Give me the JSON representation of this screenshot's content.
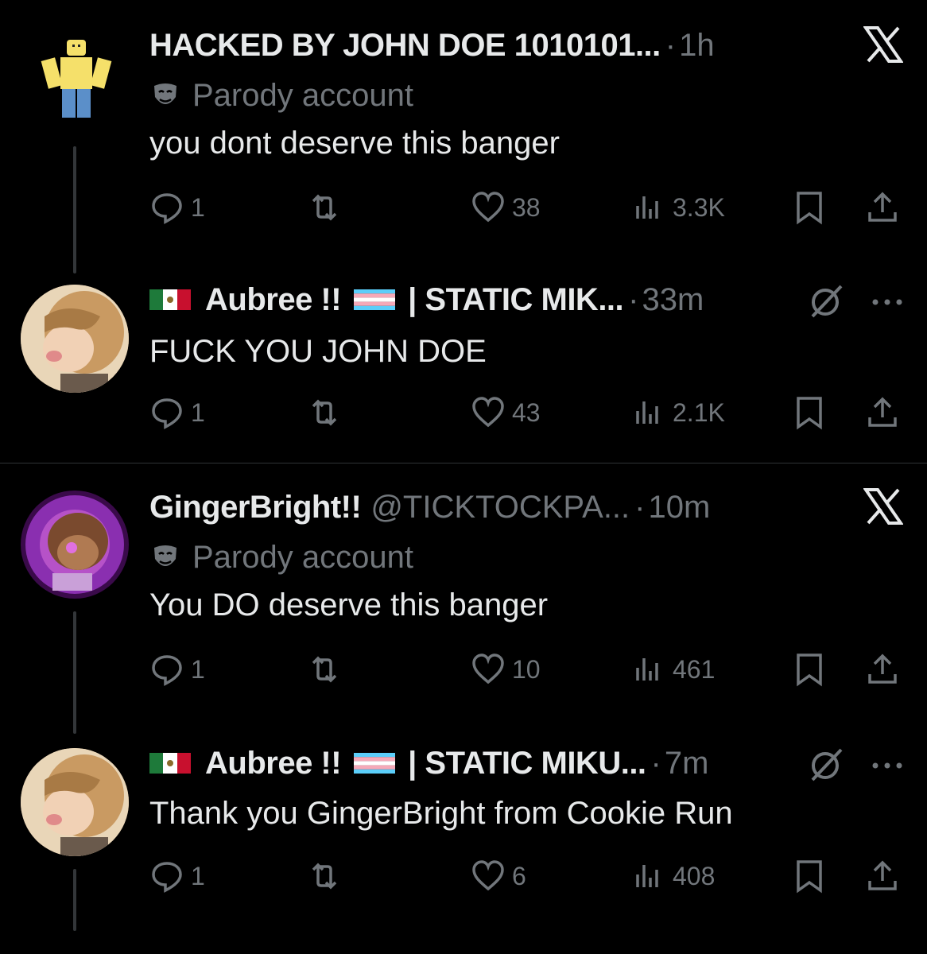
{
  "tweets": [
    {
      "name": "HACKED BY JOHN DOE 1010101...",
      "handle": "",
      "time": "1h",
      "parody_label": "Parody account",
      "text": "you dont deserve this banger",
      "replies": "1",
      "reposts": "",
      "likes": "38",
      "views": "3.3K",
      "top_icon": "x-logo-icon"
    },
    {
      "name": "Aubree !!",
      "name_suffix": "| STATIC MIK...",
      "time": "33m",
      "text": "FUCK YOU JOHN DOE",
      "replies": "1",
      "reposts": "",
      "likes": "43",
      "views": "2.1K",
      "top_icon": "grok-icon"
    },
    {
      "name": "GingerBright!!",
      "handle": "@TICKTOCKPA...",
      "time": "10m",
      "parody_label": "Parody account",
      "text": "You DO deserve this banger",
      "replies": "1",
      "reposts": "",
      "likes": "10",
      "views": "461",
      "top_icon": "x-logo-icon"
    },
    {
      "name": "Aubree !!",
      "name_suffix": "| STATIC MIKU...",
      "time": "7m",
      "text": "Thank you GingerBright from Cookie Run",
      "replies": "1",
      "reposts": "",
      "likes": "6",
      "views": "408",
      "top_icon": "grok-icon"
    }
  ],
  "separator": "·",
  "colors": {
    "background": "#000000",
    "text": "#e7e9ea",
    "muted": "#71767b",
    "divider": "#2f3336"
  }
}
